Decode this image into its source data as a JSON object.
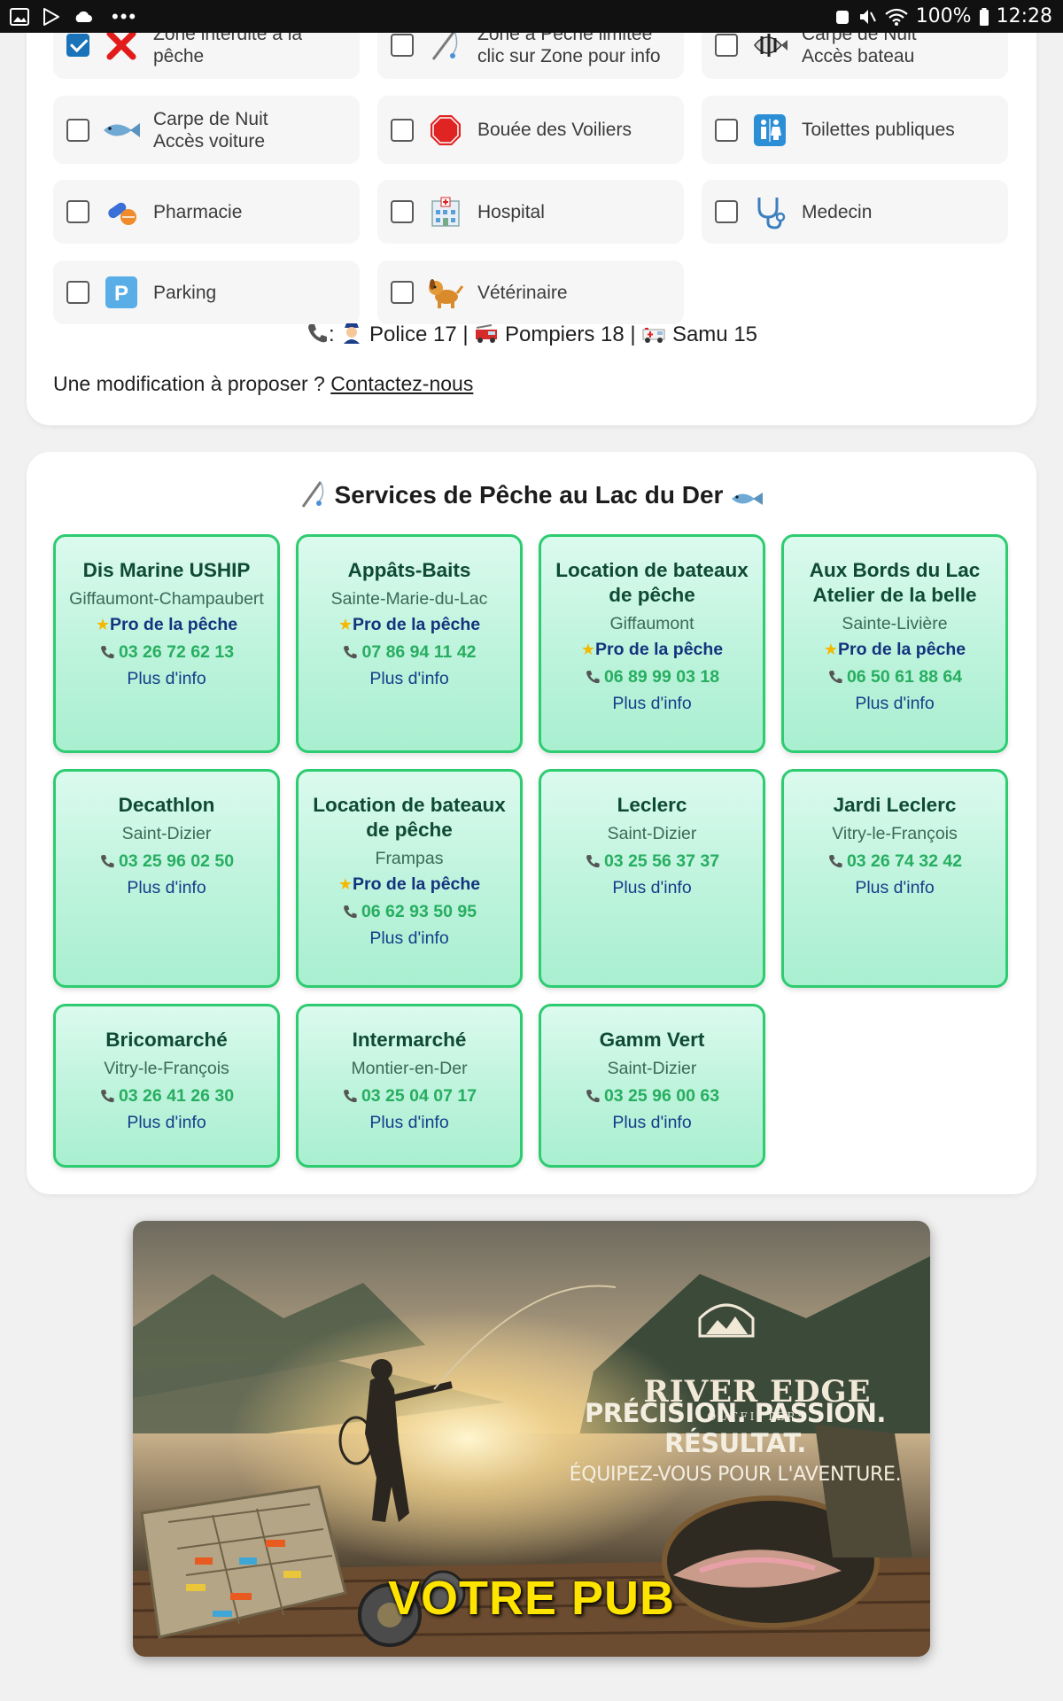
{
  "status_bar": {
    "battery_percent": "100%",
    "time": "12:28",
    "dots": "•••"
  },
  "options": [
    {
      "label": "Zone interdite à la pêche",
      "checked": true,
      "icon": "red-cross-icon"
    },
    {
      "label": "Zone à Pêche limitée clic sur Zone pour info",
      "checked": false,
      "icon": "fishing-rod-icon"
    },
    {
      "label": "Carpe de Nuit Accès bateau",
      "checked": false,
      "icon": "angelfish-icon"
    },
    {
      "label": "Carpe de Nuit Accès voiture",
      "checked": false,
      "icon": "fish-icon"
    },
    {
      "label": "Bouée des Voiliers",
      "checked": false,
      "icon": "stop-sign-icon"
    },
    {
      "label": "Toilettes publiques",
      "checked": false,
      "icon": "restroom-icon"
    },
    {
      "label": "Pharmacie",
      "checked": false,
      "icon": "pills-icon"
    },
    {
      "label": "Hospital",
      "checked": false,
      "icon": "hospital-icon"
    },
    {
      "label": "Medecin",
      "checked": false,
      "icon": "stethoscope-icon"
    },
    {
      "label": "Parking",
      "checked": false,
      "icon": "parking-icon"
    },
    {
      "label": "Vétérinaire",
      "checked": false,
      "icon": "dog-icon"
    }
  ],
  "emergency": {
    "police": "Police 17",
    "pompiers": "Pompiers 18",
    "samu": "Samu 15",
    "sep": "|",
    "colon": ":"
  },
  "contact": {
    "prefix": "Une modification à proposer ?",
    "link": "Contactez-nous"
  },
  "services": {
    "title": "Services de Pêche au Lac du Der",
    "items": [
      {
        "name": "Dis Marine USHIP",
        "city": "Giffaumont-Champaubert",
        "pro": "Pro de la pêche",
        "tel": "03 26 72 62 13",
        "more": "Plus d'info"
      },
      {
        "name": "Appâts-Baits",
        "city": "Sainte-Marie-du-Lac",
        "pro": "Pro de la pêche",
        "tel": "07 86 94 11 42",
        "more": "Plus d'info"
      },
      {
        "name": "Location de bateaux de pêche",
        "city": "Giffaumont",
        "pro": "Pro de la pêche",
        "tel": "06 89 99 03 18",
        "more": "Plus d'info"
      },
      {
        "name": "Aux Bords du Lac Atelier de la belle",
        "city": "Sainte-Livière",
        "pro": "Pro de la pêche",
        "tel": "06 50 61 88 64",
        "more": "Plus d'info"
      },
      {
        "name": "Decathlon",
        "city": "Saint-Dizier",
        "pro": "",
        "tel": "03 25 96 02 50",
        "more": "Plus d'info"
      },
      {
        "name": "Location de bateaux de pêche",
        "city": "Frampas",
        "pro": "Pro de la pêche",
        "tel": "06 62 93 50 95",
        "more": "Plus d'info"
      },
      {
        "name": "Leclerc",
        "city": "Saint-Dizier",
        "pro": "",
        "tel": "03 25 56 37 37",
        "more": "Plus d'info"
      },
      {
        "name": "Jardi Leclerc",
        "city": "Vitry-le-François",
        "pro": "",
        "tel": "03 26 74 32 42",
        "more": "Plus d'info"
      },
      {
        "name": "Bricomarché",
        "city": "Vitry-le-François",
        "pro": "",
        "tel": "03 26 41 26 30",
        "more": "Plus d'info"
      },
      {
        "name": "Intermarché",
        "city": "Montier-en-Der",
        "pro": "",
        "tel": "03 25 04 07 17",
        "more": "Plus d'info"
      },
      {
        "name": "Gamm Vert",
        "city": "Saint-Dizier",
        "pro": "",
        "tel": "03 25 96 00 63",
        "more": "Plus d'info"
      }
    ]
  },
  "ad": {
    "brand": "RIVER EDGE",
    "brand_sub": "OUTFITTERS",
    "slogan": "PRÉCISION. PASSION. RÉSULTAT.",
    "tagline": "ÉQUIPEZ-VOUS POUR L'AVENTURE.",
    "cta": "VOTRE PUB"
  },
  "colors": {
    "accent_green": "#2ecc71",
    "phone_green": "#27ae60",
    "link_blue": "#143e8a",
    "checkbox_blue": "#1a73b8",
    "ad_cta_yellow": "#ffe400"
  }
}
